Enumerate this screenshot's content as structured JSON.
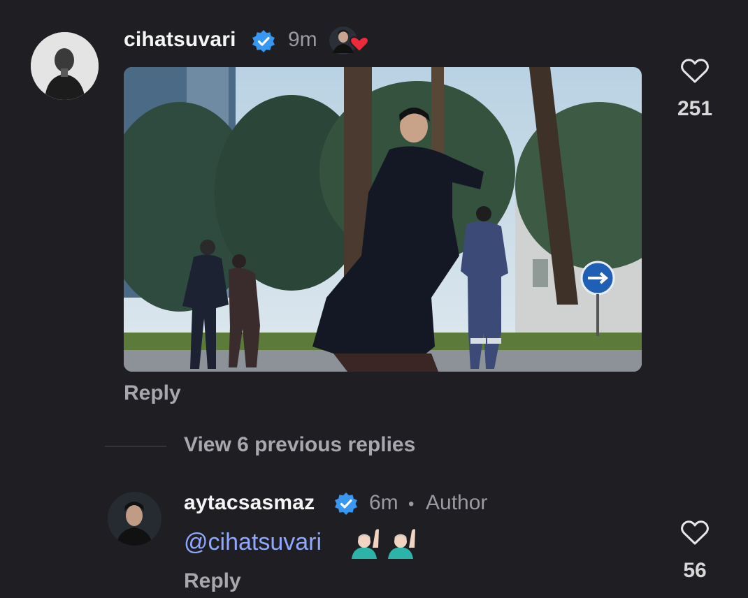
{
  "comments": [
    {
      "username": "cihatsuvari",
      "time": "9m",
      "likes": "251",
      "reply_label": "Reply",
      "icons": {
        "verified": "verified-badge-icon",
        "liked_by_author": "author-liked-heart-icon",
        "like": "heart-outline-icon"
      }
    },
    {
      "username": "aytacsasmaz",
      "time": "6m",
      "separator": "•",
      "role_badge": "Author",
      "mention": "@cihatsuvari",
      "likes": "56",
      "reply_label": "Reply",
      "icons": {
        "verified": "verified-badge-icon",
        "emoji": "raising-hand-emoji",
        "like": "heart-outline-icon"
      }
    }
  ],
  "thread": {
    "view_previous": "View 6 previous replies"
  },
  "colors": {
    "background": "#1f1f23",
    "verified": "#3897f0",
    "mention": "#8fa8ff",
    "heart_red": "#ed2a3c"
  }
}
